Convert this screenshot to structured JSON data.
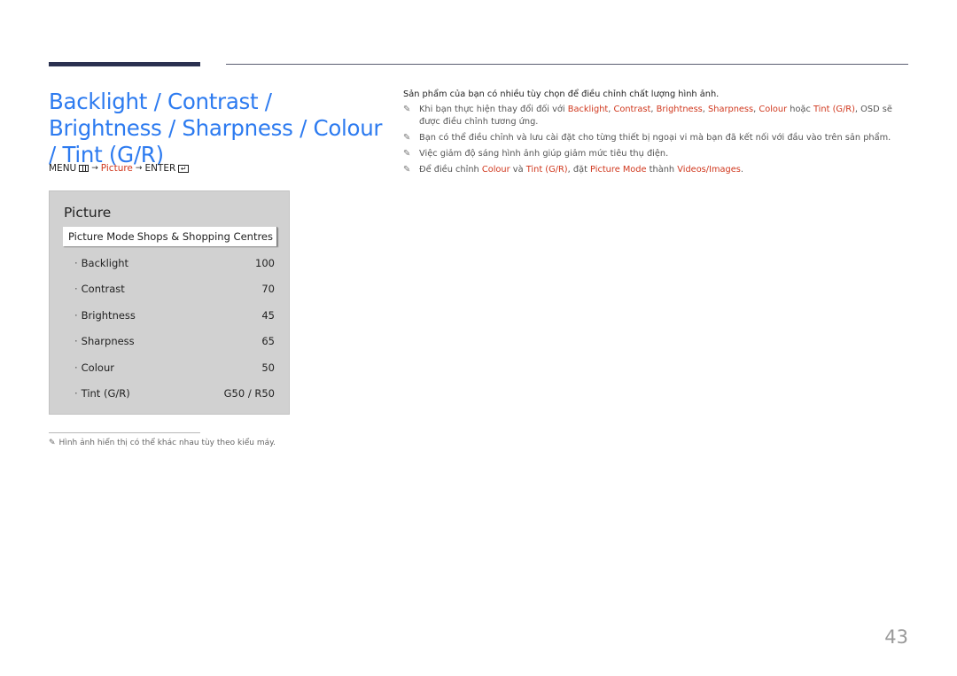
{
  "title": "Backlight / Contrast / Brightness / Sharpness / Colour / Tint (G/R)",
  "menu_path": {
    "menu": "MENU",
    "arrow": "→",
    "picture": "Picture",
    "enter": "ENTER",
    "menu_icon": "menu-icon",
    "enter_icon": "enter-icon"
  },
  "osd": {
    "title": "Picture",
    "mode_label": "Picture Mode",
    "mode_value": "Shops & Shopping Centres",
    "rows": [
      {
        "label": "Backlight",
        "value": "100"
      },
      {
        "label": "Contrast",
        "value": "70"
      },
      {
        "label": "Brightness",
        "value": "45"
      },
      {
        "label": "Sharpness",
        "value": "65"
      },
      {
        "label": "Colour",
        "value": "50"
      },
      {
        "label": "Tint (G/R)",
        "value": "G50 / R50"
      }
    ]
  },
  "footnote": "Hình ảnh hiển thị có thể khác nhau tùy theo kiểu máy.",
  "notes": {
    "intro": "Sản phẩm của bạn có nhiều tùy chọn để điều chỉnh chất lượng hình ảnh.",
    "n1": {
      "t1": "Khi bạn thực hiện thay đổi đối với ",
      "h1": "Backlight",
      "s1": ", ",
      "h2": "Contrast",
      "s2": ", ",
      "h3": "Brightness",
      "s3": ", ",
      "h4": "Sharpness",
      "s4": ", ",
      "h5": "Colour",
      "s5": " hoặc ",
      "h6": "Tint (G/R)",
      "t2": ", OSD sẽ được điều chỉnh tương ứng."
    },
    "n2": "Bạn có thể điều chỉnh và lưu cài đặt cho từng thiết bị ngoại vi mà bạn đã kết nối với đầu vào trên sản phẩm.",
    "n3": "Việc giảm độ sáng hình ảnh giúp giảm mức tiêu thụ điện.",
    "n4": {
      "t1": "Để điều chỉnh ",
      "h1": "Colour",
      "t2": " và ",
      "h2": "Tint (G/R)",
      "t3": ", đặt ",
      "h3": "Picture Mode",
      "t4": " thành ",
      "h4": "Videos/Images",
      "t5": "."
    }
  },
  "page_number": "43",
  "colors": {
    "title": "#2d7bf0",
    "highlight": "#d0381e",
    "osd_bg": "#d1d1d1"
  }
}
